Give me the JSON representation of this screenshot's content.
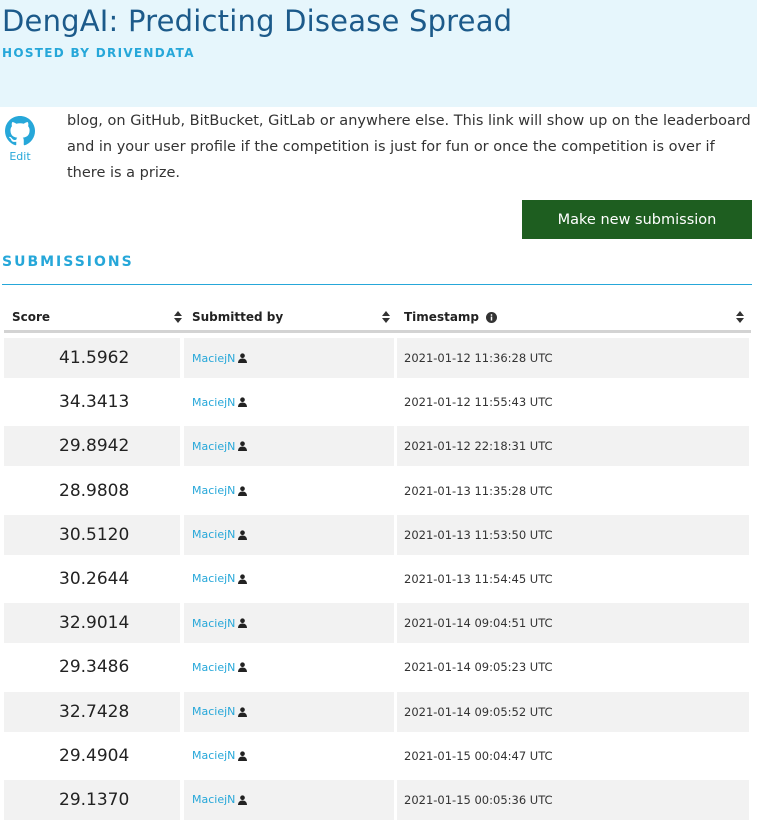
{
  "header": {
    "title": "DengAI: Predicting Disease Spread",
    "subtitle": "HOSTED BY DRIVENDATA"
  },
  "github": {
    "icon": "github-icon",
    "edit_label": "Edit"
  },
  "blurb": "blog, on GitHub, BitBucket, GitLab or anywhere else. This link will show up on the leaderboard and in your user profile if the competition is just for fun or once the competition is over if there is a prize.",
  "submit_button_label": "Make new submission",
  "submissions": {
    "section_title": "SUBMISSIONS",
    "columns": {
      "score": "Score",
      "submitted_by": "Submitted by",
      "timestamp": "Timestamp"
    },
    "rows": [
      {
        "score": "41.5962",
        "user": "MaciejN",
        "timestamp": "2021-01-12 11:36:28 UTC"
      },
      {
        "score": "34.3413",
        "user": "MaciejN",
        "timestamp": "2021-01-12 11:55:43 UTC"
      },
      {
        "score": "29.8942",
        "user": "MaciejN",
        "timestamp": "2021-01-12 22:18:31 UTC"
      },
      {
        "score": "28.9808",
        "user": "MaciejN",
        "timestamp": "2021-01-13 11:35:28 UTC"
      },
      {
        "score": "30.5120",
        "user": "MaciejN",
        "timestamp": "2021-01-13 11:53:50 UTC"
      },
      {
        "score": "30.2644",
        "user": "MaciejN",
        "timestamp": "2021-01-13 11:54:45 UTC"
      },
      {
        "score": "32.9014",
        "user": "MaciejN",
        "timestamp": "2021-01-14 09:04:51 UTC"
      },
      {
        "score": "29.3486",
        "user": "MaciejN",
        "timestamp": "2021-01-14 09:05:23 UTC"
      },
      {
        "score": "32.7428",
        "user": "MaciejN",
        "timestamp": "2021-01-14 09:05:52 UTC"
      },
      {
        "score": "29.4904",
        "user": "MaciejN",
        "timestamp": "2021-01-15 00:04:47 UTC"
      },
      {
        "score": "29.1370",
        "user": "MaciejN",
        "timestamp": "2021-01-15 00:05:36 UTC"
      }
    ]
  },
  "colors": {
    "header_bg": "#e6f6fc",
    "title": "#1c5a8a",
    "accent": "#26a7d9",
    "button_bg": "#1e5e20",
    "row_shade": "#f2f2f2"
  }
}
